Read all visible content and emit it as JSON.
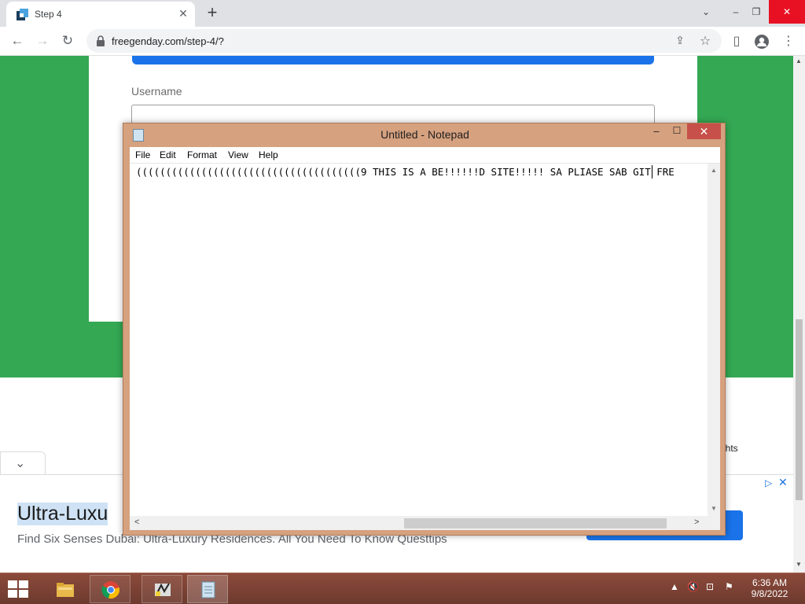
{
  "browser": {
    "tab_title": "Step 4",
    "tab_close": "✕",
    "new_tab": "+",
    "url": "freegenday.com/step-4/?"
  },
  "page": {
    "username_label": "Username",
    "rights_fragment": "ghts"
  },
  "ad": {
    "title": "Ultra-Luxu",
    "subtitle": "Find Six Senses Dubai: Ultra-Luxury Residences. All You Need To Know Questtips"
  },
  "notepad": {
    "title": "Untitled - Notepad",
    "menu": [
      "File",
      "Edit",
      "Format",
      "View",
      "Help"
    ],
    "text": "((((((((((((((((((((((((((((((((((((((9 THIS IS A BE!!!!!!D SITE!!!!! SA PLIASE SAB GIT FRE"
  },
  "taskbar": {
    "time": "6:36 AM",
    "date": "9/8/2022"
  }
}
